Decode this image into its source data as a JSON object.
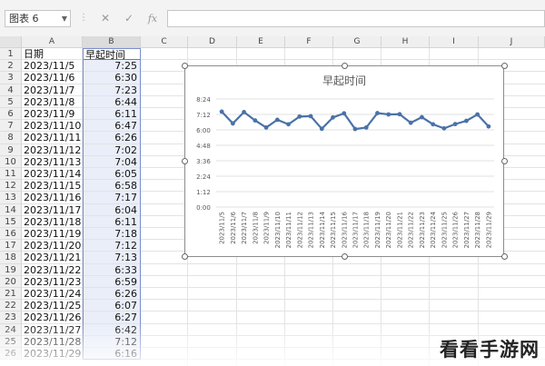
{
  "toolbar": {
    "name_box": "图表 6",
    "cancel_icon": "close-icon",
    "confirm_icon": "check-icon",
    "fx_label": "fx",
    "formula_value": ""
  },
  "columns": [
    "A",
    "B",
    "C",
    "D",
    "E",
    "F",
    "G",
    "H",
    "I",
    "J"
  ],
  "rows": [
    "1",
    "2",
    "3",
    "4",
    "5",
    "6",
    "7",
    "8",
    "9",
    "10",
    "11",
    "12",
    "13",
    "14",
    "15",
    "16",
    "17",
    "18",
    "19",
    "20",
    "21",
    "22",
    "23",
    "24",
    "25",
    "26"
  ],
  "sheet": {
    "header_a": "日期",
    "header_b": "早起时间",
    "data": [
      {
        "date": "2023/11/5",
        "time": "7:25"
      },
      {
        "date": "2023/11/6",
        "time": "6:30"
      },
      {
        "date": "2023/11/7",
        "time": "7:23"
      },
      {
        "date": "2023/11/8",
        "time": "6:44"
      },
      {
        "date": "2023/11/9",
        "time": "6:11"
      },
      {
        "date": "2023/11/10",
        "time": "6:47"
      },
      {
        "date": "2023/11/11",
        "time": "6:26"
      },
      {
        "date": "2023/11/12",
        "time": "7:02"
      },
      {
        "date": "2023/11/13",
        "time": "7:04"
      },
      {
        "date": "2023/11/14",
        "time": "6:05"
      },
      {
        "date": "2023/11/15",
        "time": "6:58"
      },
      {
        "date": "2023/11/16",
        "time": "7:17"
      },
      {
        "date": "2023/11/17",
        "time": "6:04"
      },
      {
        "date": "2023/11/18",
        "time": "6:11"
      },
      {
        "date": "2023/11/19",
        "time": "7:18"
      },
      {
        "date": "2023/11/20",
        "time": "7:12"
      },
      {
        "date": "2023/11/21",
        "time": "7:13"
      },
      {
        "date": "2023/11/22",
        "time": "6:33"
      },
      {
        "date": "2023/11/23",
        "time": "6:59"
      },
      {
        "date": "2023/11/24",
        "time": "6:26"
      },
      {
        "date": "2023/11/25",
        "time": "6:07"
      },
      {
        "date": "2023/11/26",
        "time": "6:27"
      },
      {
        "date": "2023/11/27",
        "time": "6:42"
      },
      {
        "date": "2023/11/28",
        "time": "7:12"
      },
      {
        "date": "2023/11/29",
        "time": "6:16"
      }
    ]
  },
  "chart_data": {
    "type": "line",
    "title": "早起时间",
    "x": [
      "2023/11/5",
      "2023/11/6",
      "2023/11/7",
      "2023/11/8",
      "2023/11/9",
      "2023/11/10",
      "2023/11/11",
      "2023/11/12",
      "2023/11/13",
      "2023/11/14",
      "2023/11/15",
      "2023/11/16",
      "2023/11/17",
      "2023/11/18",
      "2023/11/19",
      "2023/11/20",
      "2023/11/21",
      "2023/11/22",
      "2023/11/23",
      "2023/11/24",
      "2023/11/25",
      "2023/11/26",
      "2023/11/27",
      "2023/11/28",
      "2023/11/29"
    ],
    "values": [
      "7:25",
      "6:30",
      "7:23",
      "6:44",
      "6:11",
      "6:47",
      "6:26",
      "7:02",
      "7:04",
      "6:05",
      "6:58",
      "7:17",
      "6:04",
      "6:11",
      "7:18",
      "7:12",
      "7:13",
      "6:33",
      "6:59",
      "6:26",
      "6:07",
      "6:27",
      "6:42",
      "7:12",
      "6:16"
    ],
    "y_ticks": [
      "0:00",
      "1:12",
      "2:24",
      "3:36",
      "4:48",
      "6:00",
      "7:12",
      "8:24"
    ],
    "ylim": [
      "0:00",
      "8:24"
    ],
    "grid": true,
    "legend": "none",
    "line_color": "#4a72a8"
  },
  "watermark": "看看手游网"
}
